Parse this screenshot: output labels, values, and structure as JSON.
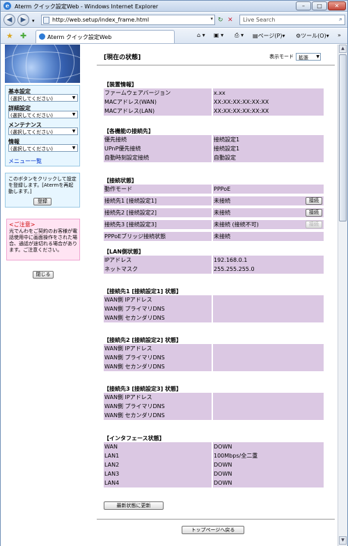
{
  "window": {
    "title": "Aterm クイック設定Web - Windows Internet Explorer"
  },
  "address": {
    "url": "http://web.setup/index_frame.html"
  },
  "search": {
    "placeholder": "Live Search"
  },
  "tab": {
    "label": "Aterm クイック設定Web"
  },
  "commands": {
    "page": "ページ(P)",
    "tools": "ツール(O)"
  },
  "sidebar": {
    "menus": [
      {
        "heading": "基本設定",
        "select": "(選択してください)"
      },
      {
        "heading": "詳細設定",
        "select": "(選択してください)"
      },
      {
        "heading": "メンテナンス",
        "select": "(選択してください)"
      },
      {
        "heading": "情報",
        "select": "(選択してください)"
      }
    ],
    "menu_list": "メニュー一覧",
    "info_text": "このボタンをクリックして設定を登録します。[Atermを再起動します。]",
    "register_button": "登録",
    "warning_title": "<ご注意>",
    "warning_text": "光でんわをご契約のお客様が電話使用中に画面操作をされた場合、通話が途切れる場合があります。ご注意ください。",
    "close_button": "閉じる"
  },
  "main": {
    "title": "[現在の状態]",
    "display_mode_label": "表示モード",
    "display_mode_value": "拡張",
    "refresh_button": "最新状態に更新",
    "top_button": "トップページへ戻る",
    "sections": [
      {
        "title": "【装置情報】",
        "rows": [
          {
            "k": "ファームウェアバージョン",
            "v": "x.xx"
          },
          {
            "k": "MACアドレス(WAN)",
            "v": "XX:XX:XX:XX:XX:XX"
          },
          {
            "k": "MACアドレス(LAN)",
            "v": "XX:XX:XX:XX:XX:XX"
          }
        ]
      },
      {
        "title": "【各機能の接続先】",
        "rows": [
          {
            "k": "優先接続",
            "v": "接続設定1"
          },
          {
            "k": "UPnP優先接続",
            "v": "接続設定1"
          },
          {
            "k": "自動時刻設定接続",
            "v": "自動設定"
          }
        ]
      },
      {
        "title": "【接続状態】",
        "rows": [
          {
            "k": "動作モード",
            "v": "PPPoE"
          },
          {
            "k": "接続先1 [接続設定1]",
            "v": "未接続",
            "btn": "接続"
          },
          {
            "k": "接続先2 [接続設定2]",
            "v": "未接続",
            "btn": "接続"
          },
          {
            "k": "接続先3 [接続設定3]",
            "v": "未接続 (接続不可)",
            "btn": "接続",
            "disabled": true
          },
          {
            "k": "PPPoEブリッジ接続状態",
            "v": "未接続"
          }
        ]
      },
      {
        "title": "【LAN側状態】",
        "rows": [
          {
            "k": "IPアドレス",
            "v": "192.168.0.1"
          },
          {
            "k": "ネットマスク",
            "v": "255.255.255.0"
          }
        ]
      },
      {
        "title": "【接続先1 [接続設定1] 状態】",
        "rows": [
          {
            "k": "WAN側 IPアドレス",
            "v": ""
          },
          {
            "k": "WAN側 プライマリDNS",
            "v": ""
          },
          {
            "k": "WAN側 セカンダリDNS",
            "v": ""
          }
        ]
      },
      {
        "title": "【接続先2 [接続設定2] 状態】",
        "rows": [
          {
            "k": "WAN側 IPアドレス",
            "v": ""
          },
          {
            "k": "WAN側 プライマリDNS",
            "v": ""
          },
          {
            "k": "WAN側 セカンダリDNS",
            "v": ""
          }
        ]
      },
      {
        "title": "【接続先3 [接続設定3] 状態】",
        "rows": [
          {
            "k": "WAN側 IPアドレス",
            "v": ""
          },
          {
            "k": "WAN側 プライマリDNS",
            "v": ""
          },
          {
            "k": "WAN側 セカンダリDNS",
            "v": ""
          }
        ]
      },
      {
        "title": "【インタフェース状態】",
        "rows": [
          {
            "k": "WAN",
            "v": "DOWN"
          },
          {
            "k": "LAN1",
            "v": "100Mbps/全二重"
          },
          {
            "k": "LAN2",
            "v": "DOWN"
          },
          {
            "k": "LAN3",
            "v": "DOWN"
          },
          {
            "k": "LAN4",
            "v": "DOWN"
          }
        ]
      }
    ]
  }
}
